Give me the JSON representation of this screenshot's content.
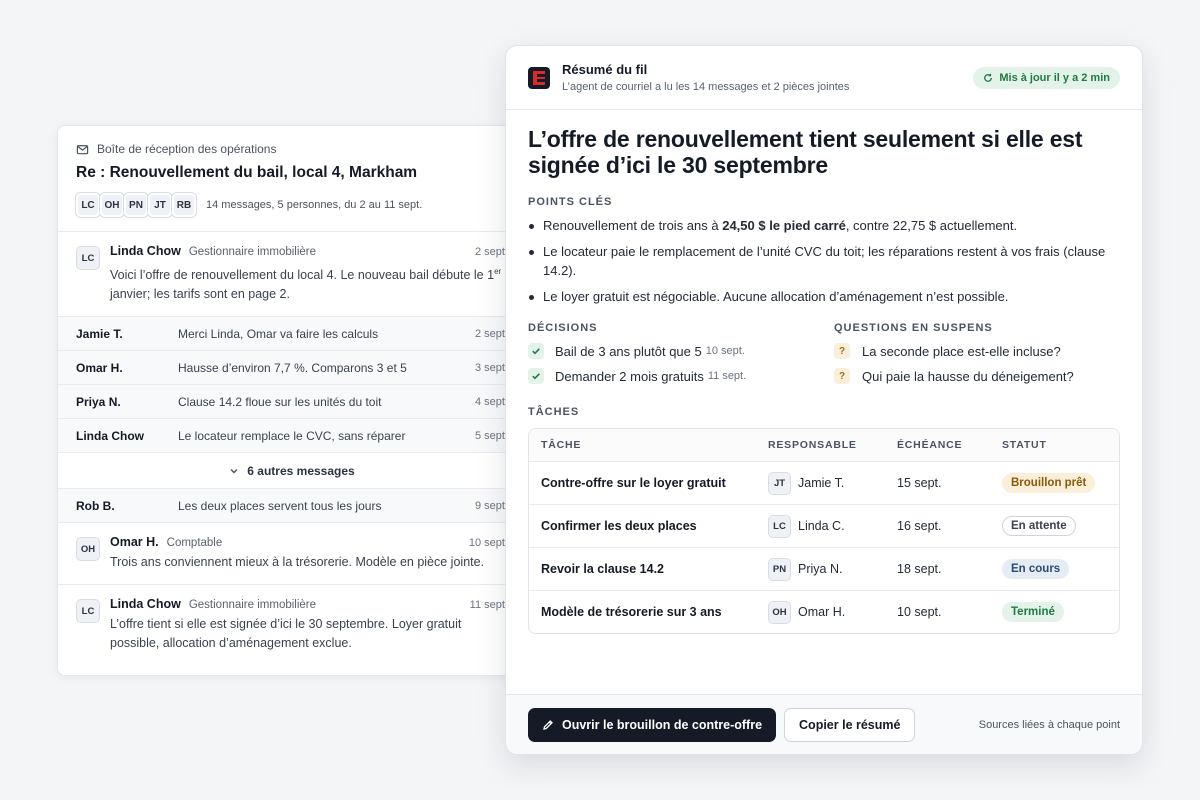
{
  "thread": {
    "inbox_label": "Boîte de réception des opérations",
    "subject": "Re : Renouvellement du bail, local 4, Markham",
    "participants": [
      "LC",
      "OH",
      "PN",
      "JT",
      "RB"
    ],
    "meta": "14 messages, 5 personnes, du 2 au 11 sept.",
    "first_message": {
      "initials": "LC",
      "sender": "Linda Chow",
      "role": "Gestionnaire immobilière",
      "date": "2 sept.",
      "text_a": "Voici l’offre de renouvellement du local 4. Le nouveau bail débute le 1",
      "text_sup": "er",
      "text_b": " janvier; les tarifs sont en page 2."
    },
    "collapsed": [
      {
        "sender": "Jamie T.",
        "snippet": "Merci Linda, Omar va faire les calculs",
        "date": "2 sept."
      },
      {
        "sender": "Omar H.",
        "snippet": "Hausse d’environ 7,7 %. Comparons 3 et 5",
        "date": "3 sept."
      },
      {
        "sender": "Priya N.",
        "snippet": "Clause 14.2 floue sur les unités du toit",
        "date": "4 sept."
      },
      {
        "sender": "Linda Chow",
        "snippet": "Le locateur remplace le CVC, sans réparer",
        "date": "5 sept."
      }
    ],
    "more_label": "6 autres messages",
    "collapsed_after": {
      "sender": "Rob B.",
      "snippet": "Les deux places servent tous les jours",
      "date": "9 sept."
    },
    "msg_omar": {
      "initials": "OH",
      "sender": "Omar H.",
      "role": "Comptable",
      "date": "10 sept.",
      "text": "Trois ans conviennent mieux à la trésorerie. Modèle en pièce jointe."
    },
    "msg_last": {
      "initials": "LC",
      "sender": "Linda Chow",
      "role": "Gestionnaire immobilière",
      "date": "11 sept.",
      "text": "L’offre tient si elle est signée d’ici le 30 septembre. Loyer gratuit possible, allocation d’aménagement exclue."
    }
  },
  "summary": {
    "title": "Résumé du fil",
    "subtitle": "L’agent de courriel a lu les 14 messages et 2 pièces jointes",
    "updated": "Mis à jour il y a 2 min",
    "headline": "L’offre de renouvellement tient seulement si elle est signée d’ici le 30 septembre",
    "key_label": "POINTS CLÉS",
    "kp1_a": "Renouvellement de trois ans à ",
    "kp1_bold": "24,50 $ le pied carré",
    "kp1_b": ", contre 22,75 $ actuellement.",
    "kp2": "Le locateur paie le remplacement de l’unité CVC du toit; les réparations restent à vos frais (clause 14.2).",
    "kp3": "Le loyer gratuit est négociable. Aucune allocation d’aménagement n’est possible.",
    "decisions_label": "DÉCISIONS",
    "decisions": [
      {
        "text": "Bail de 3 ans plutôt que 5",
        "date": "10 sept."
      },
      {
        "text": "Demander 2 mois gratuits",
        "date": "11 sept."
      }
    ],
    "questions_label": "QUESTIONS EN SUSPENS",
    "questions": [
      {
        "mark": "?",
        "text": "La seconde place est-elle incluse?"
      },
      {
        "mark": "?",
        "text": "Qui paie la hausse du déneigement?"
      }
    ],
    "tasks_label": "TÂCHES",
    "task_headers": {
      "task": "TÂCHE",
      "owner": "RESPONSABLE",
      "due": "ÉCHÉANCE",
      "status": "STATUT"
    },
    "tasks": [
      {
        "name": "Contre-offre sur le loyer gratuit",
        "initials": "JT",
        "owner": "Jamie T.",
        "due": "15 sept.",
        "status": "Brouillon prêt"
      },
      {
        "name": "Confirmer les deux places",
        "initials": "LC",
        "owner": "Linda C.",
        "due": "16 sept.",
        "status": "En attente"
      },
      {
        "name": "Revoir la clause 14.2",
        "initials": "PN",
        "owner": "Priya N.",
        "due": "18 sept.",
        "status": "En cours"
      },
      {
        "name": "Modèle de trésorerie sur 3 ans",
        "initials": "OH",
        "owner": "Omar H.",
        "due": "10 sept.",
        "status": "Terminé"
      }
    ],
    "primary_button": "Ouvrir le brouillon de contre-offre",
    "secondary_button": "Copier le résumé",
    "sources": "Sources liées à chaque point"
  },
  "colors": {
    "accent_dark": "#141a26",
    "brand_red": "#d92b2b",
    "success": "#1f7a45",
    "warning": "#a26a10"
  },
  "icons": {
    "inbox": "mail-icon",
    "refresh": "refresh-icon",
    "check": "check-icon",
    "chevron": "chevron-down-icon",
    "pencil": "pencil-icon"
  }
}
